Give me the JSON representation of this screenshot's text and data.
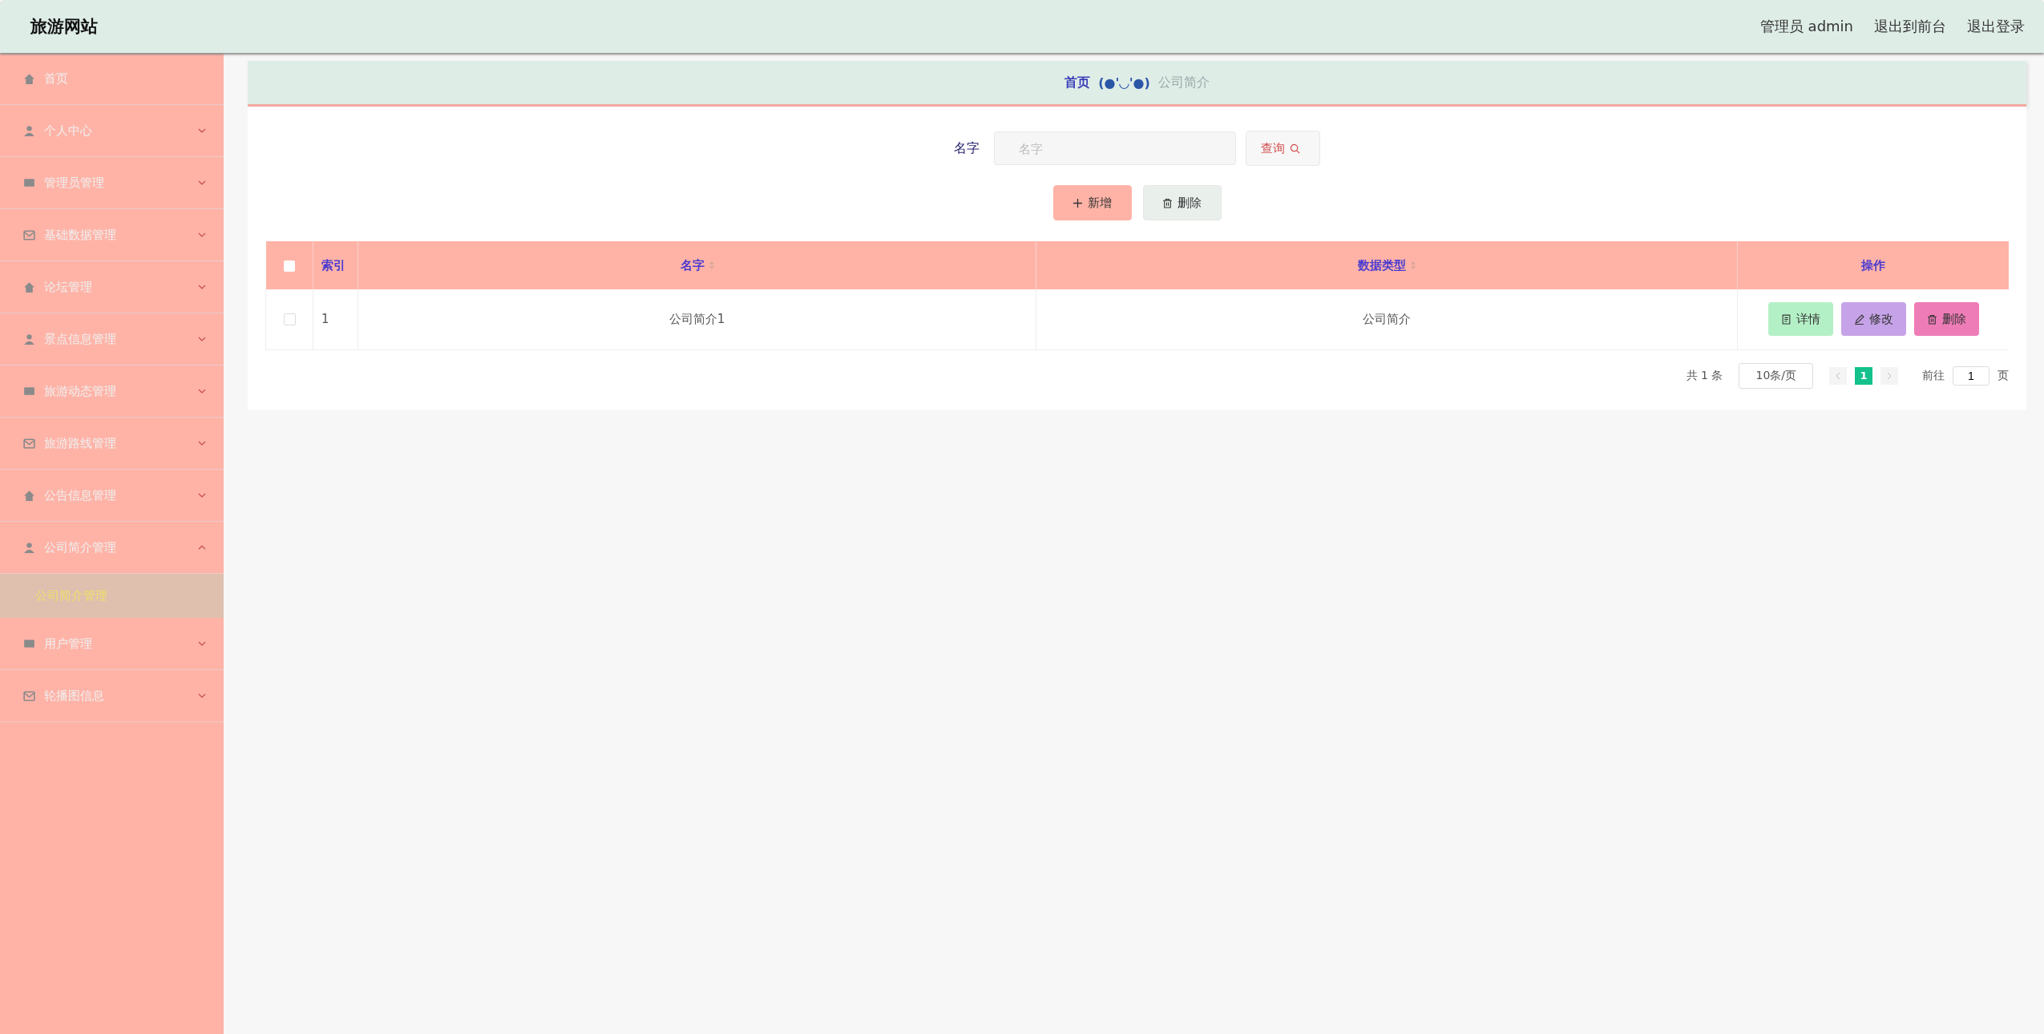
{
  "header": {
    "title": "旅游网站",
    "user": "管理员 admin",
    "links": [
      "退出到前台",
      "退出登录"
    ]
  },
  "sidebar": {
    "items": [
      {
        "label": "首页",
        "kind": "link"
      },
      {
        "label": "个人中心",
        "kind": "submenu",
        "expanded": false
      },
      {
        "label": "管理员管理",
        "kind": "submenu",
        "expanded": false
      },
      {
        "label": "基础数据管理",
        "kind": "submenu",
        "expanded": false
      },
      {
        "label": "论坛管理",
        "kind": "submenu",
        "expanded": false
      },
      {
        "label": "景点信息管理",
        "kind": "submenu",
        "expanded": false
      },
      {
        "label": "旅游动态管理",
        "kind": "submenu",
        "expanded": false
      },
      {
        "label": "旅游路线管理",
        "kind": "submenu",
        "expanded": false
      },
      {
        "label": "公告信息管理",
        "kind": "submenu",
        "expanded": false
      },
      {
        "label": "公司简介管理",
        "kind": "submenu",
        "expanded": true,
        "children": [
          {
            "label": "公司简介管理",
            "selected": true
          }
        ]
      },
      {
        "label": "用户管理",
        "kind": "submenu",
        "expanded": false
      },
      {
        "label": "轮播图信息",
        "kind": "submenu",
        "expanded": false
      }
    ]
  },
  "breadcrumb": {
    "home": "首页",
    "separator": "(●'◡'●)",
    "current": "公司简介"
  },
  "search": {
    "label": "名字",
    "placeholder": "名字",
    "button": "查询"
  },
  "actions": {
    "add": "新增",
    "delete": "删除"
  },
  "table": {
    "select_all_checked": false,
    "columns": [
      "索引",
      "名字",
      "数据类型",
      "操作"
    ],
    "rows": [
      {
        "checked": false,
        "cells": [
          "1",
          "公司简介1",
          "公司简介"
        ],
        "buttons": [
          "详情",
          "修改",
          "删除"
        ]
      }
    ]
  },
  "pagination": {
    "total": "共 1 条",
    "page_size": "10条/页",
    "pages": [
      {
        "label": "1",
        "selected": true
      }
    ],
    "goto_label": "前往",
    "goto_value": "1",
    "goto_suffix": "页"
  }
}
